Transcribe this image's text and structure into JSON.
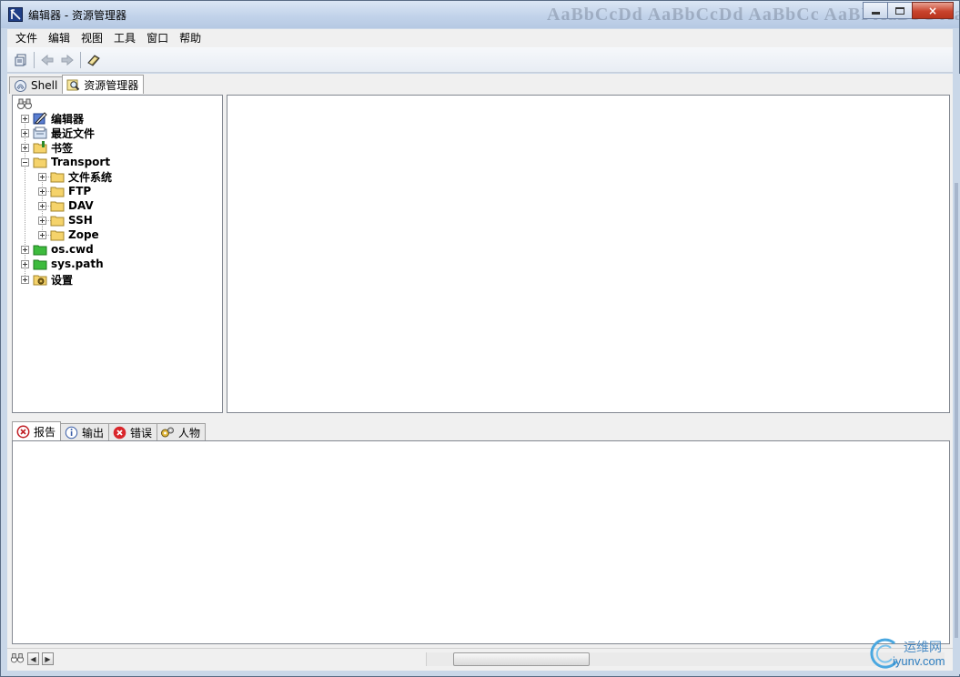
{
  "window": {
    "title": "编辑器 - 资源管理器",
    "watermark_text": "AaBbCcDd  AaBbCcDd  AaBbCc  AaBI  AaBbC  AaBb",
    "controls": {
      "minimize": "minimize",
      "maximize": "maximize",
      "close": "×"
    }
  },
  "menu": [
    "文件",
    "编辑",
    "视图",
    "工具",
    "窗口",
    "帮助"
  ],
  "toolbar": {
    "icons": [
      "print-preview-icon",
      "back-arrow-icon",
      "forward-arrow-icon",
      "book-icon"
    ]
  },
  "top_tabs": [
    {
      "label": "Shell",
      "icon": "shell-icon",
      "active": false
    },
    {
      "label": "资源管理器",
      "icon": "magnifier-icon",
      "active": true
    }
  ],
  "tree": {
    "root_icon": "binoculars-icon",
    "items": [
      {
        "label": "编辑器",
        "icon": "editor-icon",
        "expanded": false,
        "level": 0
      },
      {
        "label": "最近文件",
        "icon": "recent-files-icon",
        "expanded": false,
        "level": 0
      },
      {
        "label": "书签",
        "icon": "bookmark-folder-icon",
        "expanded": false,
        "level": 0
      },
      {
        "label": "Transport",
        "icon": "folder-icon",
        "expanded": true,
        "level": 0
      },
      {
        "label": "文件系统",
        "icon": "folder-icon",
        "expanded": false,
        "level": 1
      },
      {
        "label": "FTP",
        "icon": "folder-icon",
        "expanded": false,
        "level": 1
      },
      {
        "label": "DAV",
        "icon": "folder-icon",
        "expanded": false,
        "level": 1
      },
      {
        "label": "SSH",
        "icon": "folder-icon",
        "expanded": false,
        "level": 1
      },
      {
        "label": "Zope",
        "icon": "folder-icon",
        "expanded": false,
        "level": 1
      },
      {
        "label": "os.cwd",
        "icon": "green-folder-icon",
        "expanded": false,
        "level": 0
      },
      {
        "label": "sys.path",
        "icon": "green-folder-icon",
        "expanded": false,
        "level": 0
      },
      {
        "label": "设置",
        "icon": "settings-folder-icon",
        "expanded": false,
        "level": 0
      }
    ]
  },
  "bottom_tabs": [
    {
      "label": "报告",
      "icon": "report-icon",
      "active": true
    },
    {
      "label": "输出",
      "icon": "info-icon",
      "active": false
    },
    {
      "label": "错误",
      "icon": "error-icon",
      "active": false
    },
    {
      "label": "人物",
      "icon": "gears-icon",
      "active": false
    }
  ],
  "site_watermark": {
    "line1": "运维网",
    "line2": "iyunv.com"
  },
  "colors": {
    "frame": "#c9d7e8",
    "folder": "#f5d36b",
    "green_folder": "#3dbb3d",
    "error_red": "#d9262b"
  }
}
